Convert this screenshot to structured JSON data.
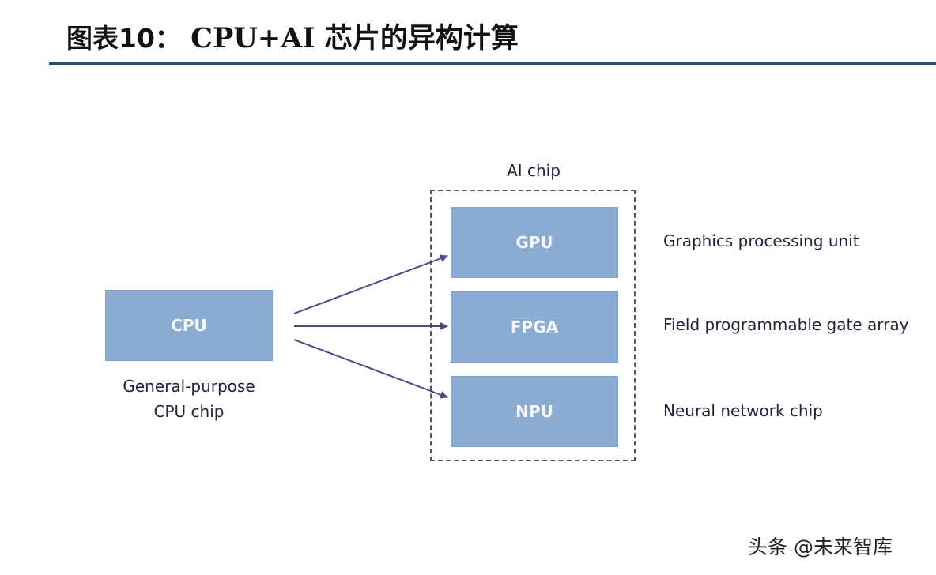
{
  "header": {
    "figure_prefix": "图表10：",
    "title": "CPU+AI 芯片的异构计算"
  },
  "diagram": {
    "cpu": {
      "label": "CPU",
      "caption_line1": "General-purpose",
      "caption_line2": "CPU chip"
    },
    "ai_group": {
      "label": "AI chip",
      "chips": [
        {
          "label": "GPU",
          "description": "Graphics processing unit"
        },
        {
          "label": "FPGA",
          "description": "Field programmable gate array"
        },
        {
          "label": "NPU",
          "description": "Neural network chip"
        }
      ]
    },
    "colors": {
      "box_fill": "#8aacd3",
      "arrow": "#4a4a8c",
      "rule": "#1f4e79"
    }
  },
  "watermark": "头条 @未来智库"
}
